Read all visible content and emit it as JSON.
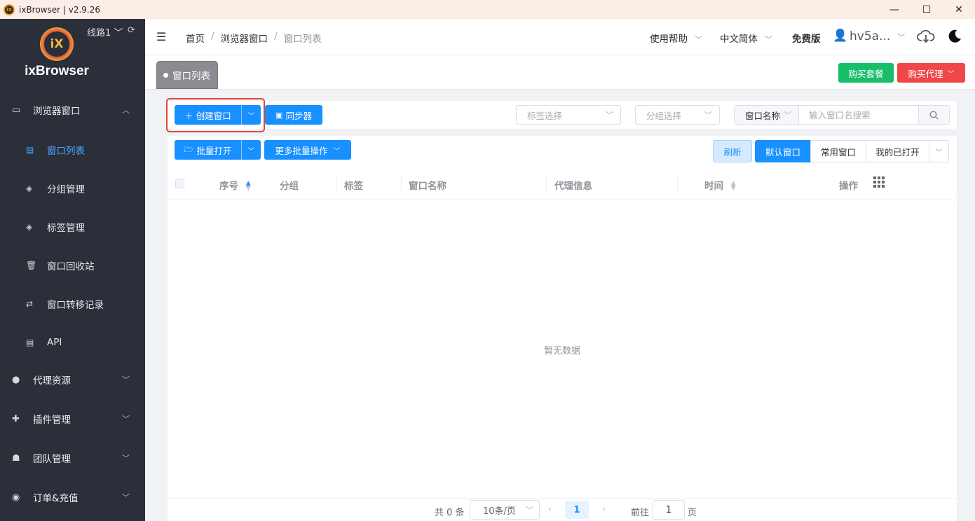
{
  "window": {
    "title": "ixBrowser | v2.9.26",
    "min": "—",
    "max": "☐",
    "close": "✕"
  },
  "sidebar": {
    "brand": "ixBrowser",
    "logo_text": "iX",
    "line": "线路1",
    "groups": [
      {
        "label": "浏览器窗口",
        "icon": "window-icon"
      },
      {
        "label": "代理资源",
        "icon": "globe-icon"
      },
      {
        "label": "插件管理",
        "icon": "puzzle-icon"
      },
      {
        "label": "团队管理",
        "icon": "team-icon"
      },
      {
        "label": "订单&充值",
        "icon": "coin-icon"
      }
    ],
    "subitems": [
      {
        "label": "窗口列表",
        "icon": "window-icon",
        "active": true
      },
      {
        "label": "分组管理",
        "icon": "layers-icon"
      },
      {
        "label": "标签管理",
        "icon": "layers-icon"
      },
      {
        "label": "窗口回收站",
        "icon": "trash-icon"
      },
      {
        "label": "窗口转移记录",
        "icon": "transfer-icon"
      },
      {
        "label": "API",
        "icon": "window-icon"
      }
    ]
  },
  "topnav": {
    "breadcrumb": [
      "首页",
      "浏览器窗口",
      "窗口列表"
    ],
    "help": "使用帮助",
    "language": "中文简体",
    "plan": "免费版",
    "username": "hv5a..."
  },
  "tabs": {
    "active": "窗口列表",
    "buy_plan": "购买套餐",
    "buy_proxy": "购买代理"
  },
  "toolbar": {
    "create_window": "创建窗口",
    "sync": "同步器",
    "tag_select_placeholder": "标签选择",
    "group_select_placeholder": "分组选择",
    "search_field": "窗口名称",
    "search_placeholder": "输入窗口名搜索"
  },
  "actions": {
    "batch_open": "批量打开",
    "more_batch": "更多批量操作",
    "refresh": "刷新",
    "filters": [
      "默认窗口",
      "常用窗口",
      "我的已打开"
    ]
  },
  "table": {
    "columns": [
      "序号",
      "分组",
      "标签",
      "窗口名称",
      "代理信息",
      "时间",
      "操作"
    ],
    "empty_text": "暂无数据"
  },
  "pagination": {
    "total": "共 0 条",
    "page_size": "10条/页",
    "current_page": "1",
    "goto_label": "前往",
    "goto_value": "1",
    "page_suffix": "页"
  },
  "colors": {
    "primary": "#1890ff",
    "sidebar_bg": "#2b2f3a",
    "buy_plan": "#19be6b",
    "buy_proxy": "#f04848"
  }
}
